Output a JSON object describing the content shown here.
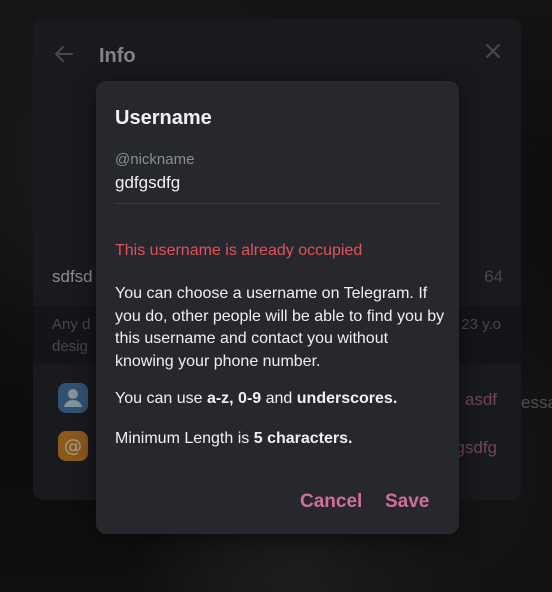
{
  "info": {
    "title": "Info",
    "name": "sdfsd",
    "count": "64",
    "bio_line1": "Any d",
    "bio_line2": "desig",
    "bio_age": "23 y.o",
    "username_value": "asdf",
    "link_value": "gsdfg",
    "stray_text": "essa"
  },
  "dialog": {
    "title": "Username",
    "field": {
      "placeholder": "@nickname",
      "value": "gdfgsdfg"
    },
    "error": "This username is already occupied",
    "description": "You can choose a username on Telegram. If you do, other people will be able to find you by this username and contact you without knowing your phone number.",
    "chars_prefix": "You can use ",
    "chars_bold1": "a-z, 0-9",
    "chars_mid": " and ",
    "chars_bold2": "underscores.",
    "min_prefix": "Minimum Length is ",
    "min_bold": "5 characters.",
    "cancel_label": "Cancel",
    "save_label": "Save"
  },
  "colors": {
    "accent": "#cf6f9a",
    "error": "#e0525a",
    "dialog_bg": "#26282e"
  }
}
